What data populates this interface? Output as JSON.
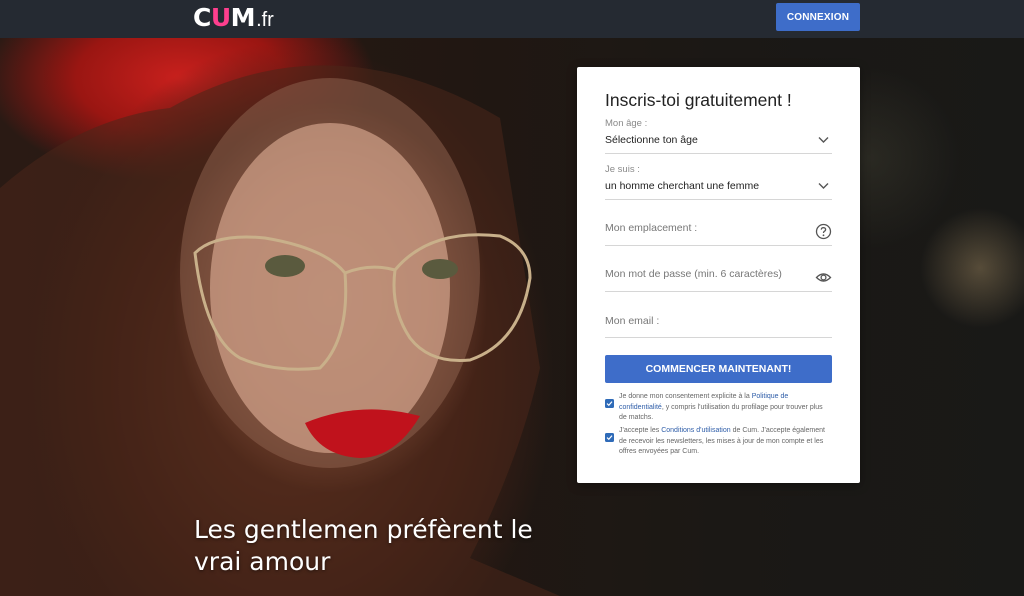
{
  "header": {
    "logo_main": "C",
    "logo_u": "U",
    "logo_m": "M",
    "logo_tld": ".fr",
    "login_label": "CONNEXION"
  },
  "hero": {
    "tagline": "Les gentlemen préfèrent le vrai amour"
  },
  "signup": {
    "title": "Inscris-toi gratuitement !",
    "age": {
      "label": "Mon âge :",
      "value": "Sélectionne ton âge"
    },
    "gender": {
      "label": "Je suis :",
      "value": "un homme cherchant une femme"
    },
    "location": {
      "placeholder": "Mon emplacement :"
    },
    "password": {
      "placeholder": "Mon mot de passe (min. 6 caractères)"
    },
    "email": {
      "placeholder": "Mon email :"
    },
    "cta_label": "COMMENCER MAINTENANT!",
    "consent1": {
      "before": "Je donne mon consentement explicite à la ",
      "link": "Politique de confidentialité",
      "after": ", y compris l'utilisation du profilage pour trouver plus de matchs."
    },
    "consent2": {
      "before": "J'accepte les ",
      "link": "Conditions d'utilisation",
      "after": " de Cum. J'accepte également de recevoir les newsletters, les mises à jour de mon compte et les offres envoyées par Cum."
    }
  },
  "colors": {
    "accent": "#3e6dc9",
    "logo_u": "#ff3f8e",
    "topbar": "#252a32"
  }
}
